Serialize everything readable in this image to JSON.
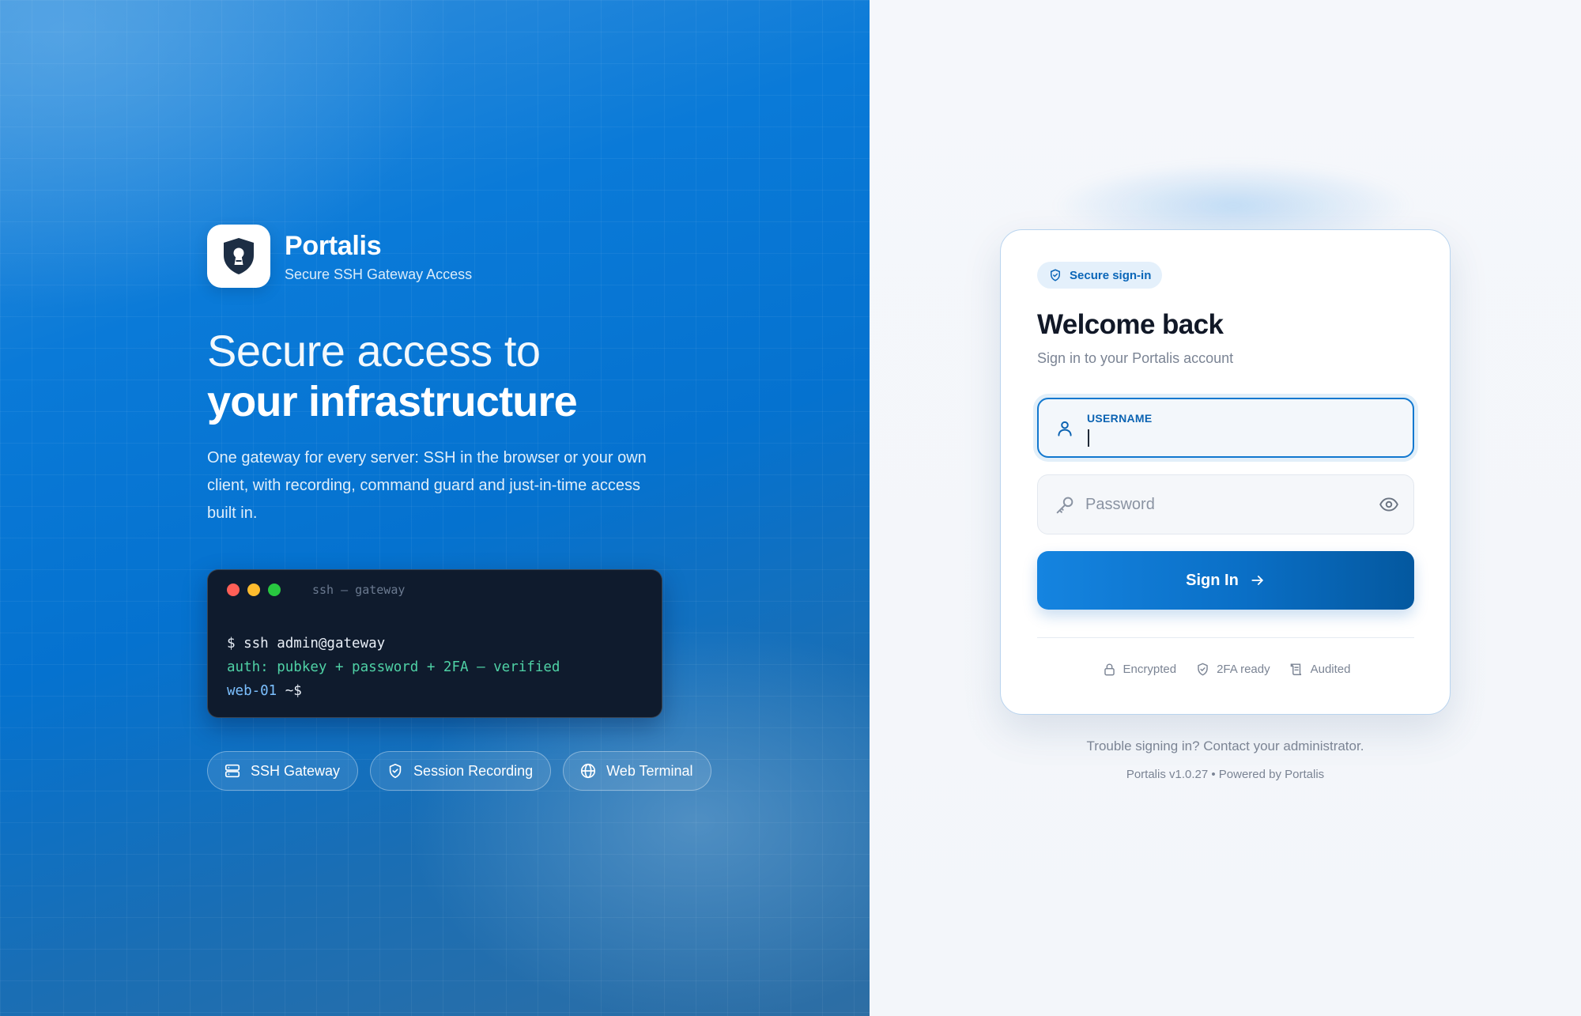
{
  "brand": {
    "name": "Portalis",
    "tagline": "Secure SSH Gateway Access"
  },
  "hero": {
    "headline_light": "Secure access to",
    "headline_bold": "your infrastructure",
    "lead": "One gateway for every server: SSH in the browser or your own client, with recording, command guard and just-in-time access built in."
  },
  "terminal": {
    "title": "ssh — gateway",
    "line1": "$ ssh admin@gateway",
    "line2": "auth: pubkey + password + 2FA — verified",
    "host": "web-01",
    "prompt": " ~$"
  },
  "chips": [
    {
      "label": "SSH Gateway",
      "icon": "server-icon"
    },
    {
      "label": "Session Recording",
      "icon": "shield-check-icon"
    },
    {
      "label": "Web Terminal",
      "icon": "globe-icon"
    }
  ],
  "login": {
    "badge": "Secure sign-in",
    "title": "Welcome back",
    "subtitle": "Sign in to your Portalis account",
    "username_label": "USERNAME",
    "password_placeholder": "Password",
    "signin_label": "Sign In",
    "trust": [
      {
        "label": "Encrypted",
        "icon": "lock-icon"
      },
      {
        "label": "2FA ready",
        "icon": "shield-check-icon"
      },
      {
        "label": "Audited",
        "icon": "scroll-icon"
      }
    ]
  },
  "footer": {
    "help": "Trouble signing in? Contact your administrator.",
    "version": "Portalis v1.0.27 • Powered by Portalis"
  },
  "colors": {
    "accent": "#0a6fc6",
    "terminal_bg": "#0f1b2d",
    "success_text": "#4fd1a5",
    "dot_red": "#ff5f57",
    "dot_yellow": "#febc2e",
    "dot_green": "#28c840"
  }
}
